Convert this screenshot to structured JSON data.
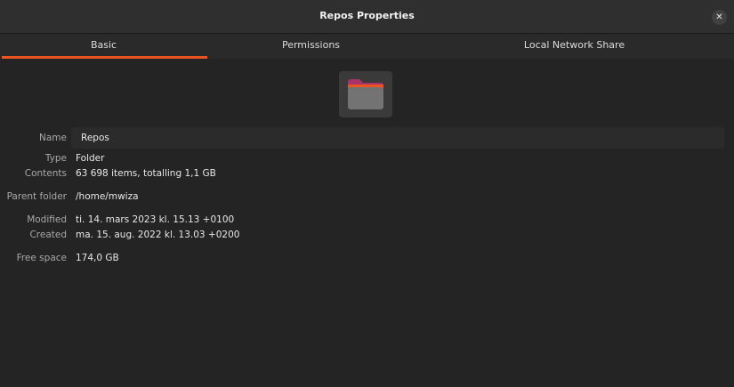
{
  "window": {
    "title": "Repos Properties"
  },
  "tabs": [
    {
      "label": "Basic",
      "active": true
    },
    {
      "label": "Permissions",
      "active": false
    },
    {
      "label": "Local Network Share",
      "active": false
    }
  ],
  "icon": {
    "name": "folder-icon",
    "accent": "#e95420",
    "tab_color": "#a8336a"
  },
  "properties": {
    "name": {
      "label": "Name",
      "value": "Repos"
    },
    "type": {
      "label": "Type",
      "value": "Folder"
    },
    "contents": {
      "label": "Contents",
      "value": "63 698 items, totalling 1,1 GB"
    },
    "parent": {
      "label": "Parent folder",
      "value": "/home/mwiza"
    },
    "modified": {
      "label": "Modified",
      "value": "ti. 14. mars 2023 kl. 15.13 +0100"
    },
    "created": {
      "label": "Created",
      "value": "ma. 15. aug. 2022 kl. 13.03 +0200"
    },
    "free_space": {
      "label": "Free space",
      "value": "174,0 GB"
    }
  }
}
